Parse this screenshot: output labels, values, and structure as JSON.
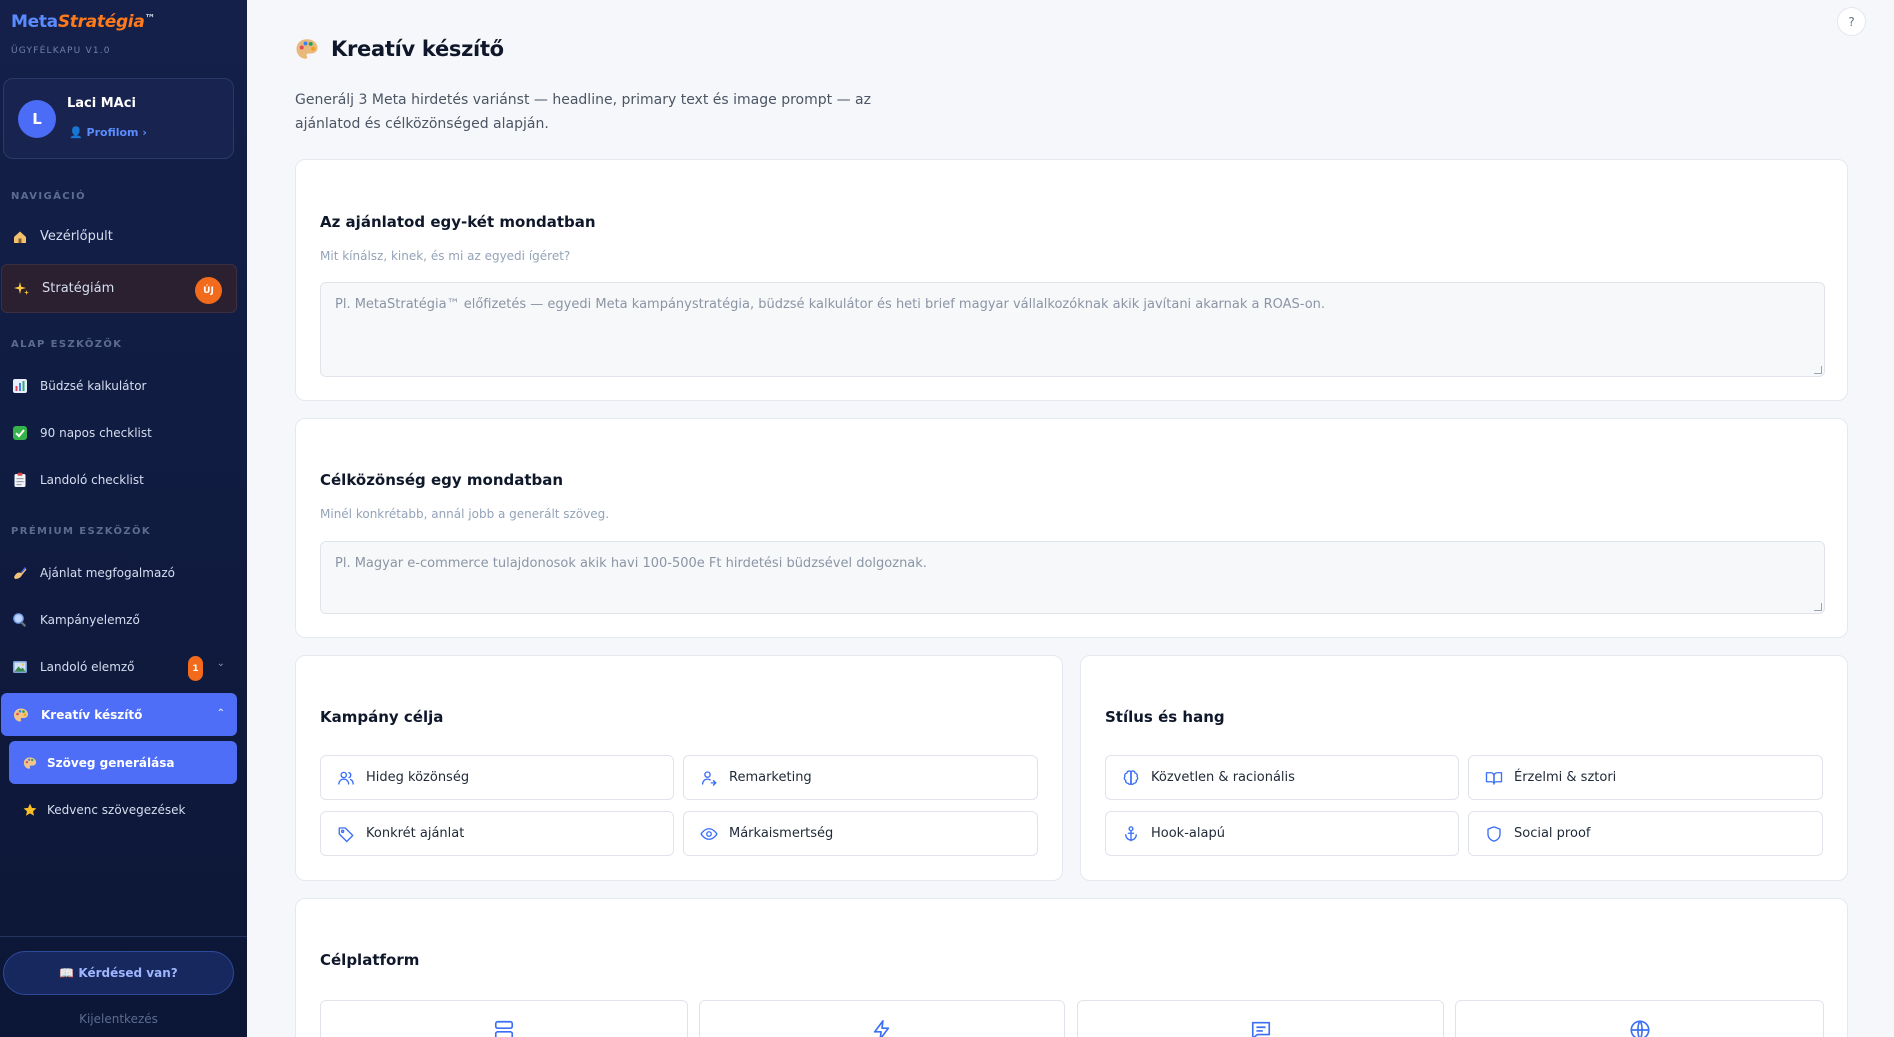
{
  "brand": {
    "part1": "Meta",
    "part2": "Stratégia",
    "tm": "™",
    "subtitle": "ÜGYFÉLKAPU V1.0"
  },
  "user": {
    "initial": "L",
    "name": "Laci MAci",
    "profile_link": "👤 Profilom ›"
  },
  "nav": {
    "section_nav": "NAVIGÁCIÓ",
    "dashboard": "Vezérlőpult",
    "strategy": "Stratégiám",
    "strategy_badge": "ÚJ",
    "section_basic": "ALAP ESZKÖZÖK",
    "budget": "Büdzsé kalkulátor",
    "checklist90": "90 napos checklist",
    "landing_checklist": "Landoló checklist",
    "section_premium": "PRÉMIUM ESZKÖZÖK",
    "offer": "Ajánlat megfogalmazó",
    "campaign": "Kampányelemző",
    "landing_analyzer": "Landoló elemző",
    "landing_badge": "1",
    "creative": "Kreatív készítő",
    "text_gen": "Szöveg generálása",
    "favorites": "Kedvenc szövegezések",
    "help": "📖 Kérdésed van?",
    "logout": "Kijelentkezés"
  },
  "main": {
    "help_button": "?",
    "title": "Kreatív készítő",
    "description": "Generálj 3 Meta hirdetés variánst — headline, primary text és image prompt — az ajánlatod és célközönséged alapján.",
    "offer_card": {
      "title": "Az ajánlatod egy-két mondatban",
      "hint": "Mit kínálsz, kinek, és mi az egyedi ígéret?",
      "placeholder": "Pl. MetaStratégia™ előfizetés — egyedi Meta kampánystratégia, büdzsé kalkulátor és heti brief magyar vállalkozóknak akik javítani akarnak a ROAS-on."
    },
    "audience_card": {
      "title": "Célközönség egy mondatban",
      "hint": "Minél konkrétabb, annál jobb a generált szöveg.",
      "placeholder": "Pl. Magyar e-commerce tulajdonosok akik havi 100-500e Ft hirdetési büdzsével dolgoznak."
    },
    "goal_card": {
      "title": "Kampány célja",
      "options": [
        "Hideg közönség",
        "Remarketing",
        "Konkrét ajánlat",
        "Márkaismertség"
      ]
    },
    "style_card": {
      "title": "Stílus és hang",
      "options": [
        "Közvetlen & racionális",
        "Érzelmi & sztori",
        "Hook-alapú",
        "Social proof"
      ]
    },
    "platform_card": {
      "title": "Célplatform"
    }
  },
  "icons": {
    "dashboard": "house-icon",
    "strategy": "sparkles-icon",
    "budget": "bar-chart-icon",
    "checklist90": "check-box-icon",
    "landing_checklist": "clipboard-icon",
    "offer": "writing-hand-icon",
    "campaign": "magnifier-icon",
    "landing_analyzer": "picture-icon",
    "creative": "palette-icon",
    "favorites": "star-icon"
  },
  "colors": {
    "accent": "#4f6ef7",
    "orange": "#f26a1b",
    "sidebar": "#14204a"
  }
}
